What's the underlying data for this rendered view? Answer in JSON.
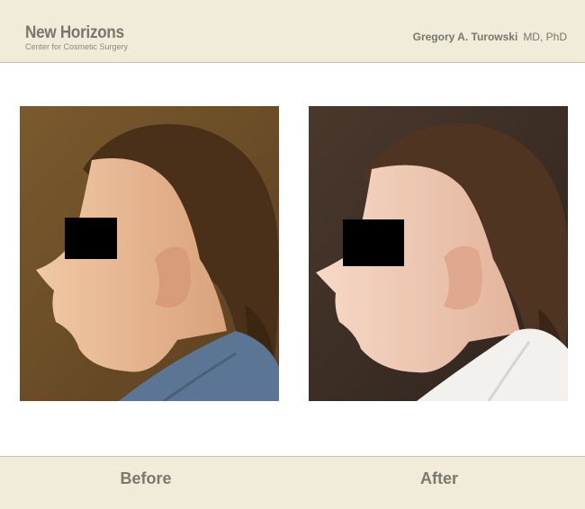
{
  "header": {
    "brand_name": "New Horizons",
    "brand_subtitle": "Center for Cosmetic Surgery",
    "doctor_name": "Gregory A. Turowski",
    "doctor_degrees": "MD, PhD"
  },
  "photos": {
    "before_caption": "Before",
    "after_caption": "After"
  },
  "colors": {
    "banner_bg": "#f1ecd9",
    "banner_text": "#77766f"
  }
}
